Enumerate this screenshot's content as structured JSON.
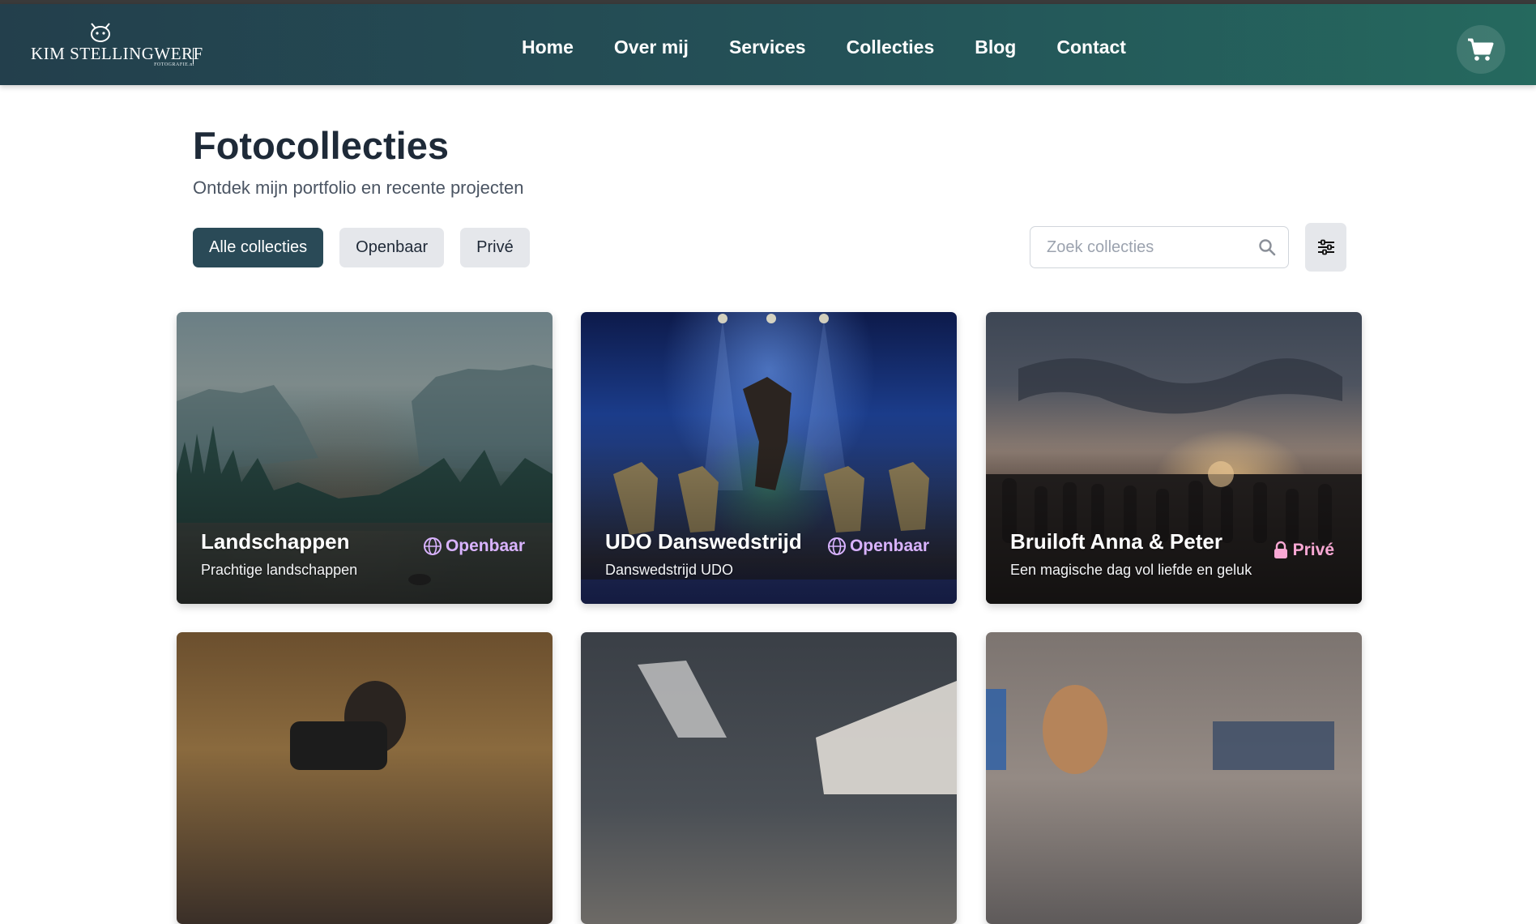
{
  "header": {
    "logo_text": "KIM STELLINGWERF",
    "logo_subtext": "FOTOGRAFIE.nl",
    "nav": [
      "Home",
      "Over mij",
      "Services",
      "Collecties",
      "Blog",
      "Contact"
    ],
    "cart_icon": "shopping-cart-icon"
  },
  "page": {
    "title": "Fotocollecties",
    "subtitle": "Ontdek mijn portfolio en recente projecten"
  },
  "filters": {
    "tabs": [
      "Alle collecties",
      "Openbaar",
      "Privé"
    ],
    "active": "Alle collecties",
    "search_placeholder": "Zoek collecties",
    "search_icon": "search-icon",
    "settings_icon": "sliders-icon"
  },
  "collections": [
    {
      "title": "Landschappen",
      "description": "Prachtige landschappen",
      "visibility": "Openbaar",
      "icon": "globe-icon"
    },
    {
      "title": "UDO Danswedstrijd",
      "description": "Danswedstrijd UDO",
      "visibility": "Openbaar",
      "icon": "globe-icon"
    },
    {
      "title": "Bruiloft Anna & Peter",
      "description": "Een magische dag vol liefde en geluk",
      "visibility": "Privé",
      "icon": "lock-icon"
    }
  ],
  "colors": {
    "header_start": "#233f4c",
    "header_end": "#25695e",
    "active_pill": "#2a4a57",
    "public_badge": "#d9b3ff",
    "private_badge": "#f9a8d4"
  }
}
